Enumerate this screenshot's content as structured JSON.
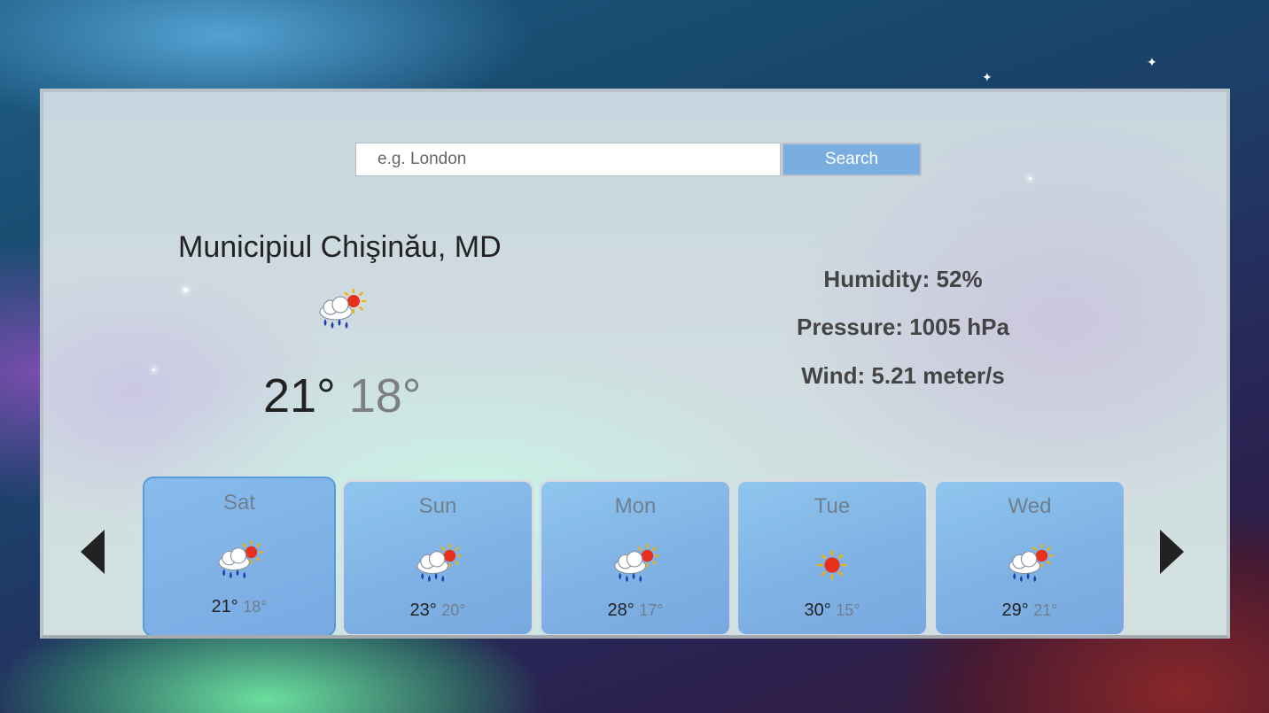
{
  "search": {
    "placeholder": "e.g. London",
    "button_label": "Search"
  },
  "current": {
    "city": "Municipiul Chişinău, MD",
    "icon": "rain-sun-icon",
    "high": "21°",
    "low": "18°",
    "humidity": "Humidity: 52%",
    "pressure": "Pressure: 1005 hPa",
    "wind": "Wind: 5.21 meter/s"
  },
  "forecast": [
    {
      "day": "Sat",
      "icon": "rain-sun-icon",
      "high": "21°",
      "low": "18°",
      "selected": true
    },
    {
      "day": "Sun",
      "icon": "rain-sun-icon",
      "high": "23°",
      "low": "20°"
    },
    {
      "day": "Mon",
      "icon": "rain-sun-icon",
      "high": "28°",
      "low": "17°"
    },
    {
      "day": "Tue",
      "icon": "sun-icon",
      "high": "30°",
      "low": "15°"
    },
    {
      "day": "Wed",
      "icon": "rain-sun-icon",
      "high": "29°",
      "low": "21°"
    }
  ],
  "colors": {
    "accent": "#7aaee0",
    "card": "#80b4e6",
    "selected_border": "#5a9ad8"
  }
}
